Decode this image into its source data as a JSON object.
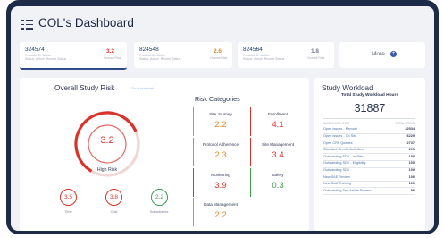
{
  "app": {
    "title": "COL's Dashboard"
  },
  "studies": [
    {
      "id": "324574",
      "subtitle": "Protocol ID: Active\nStatus: Active  Recent Status",
      "score": "3.2",
      "score_color": "#d9342b",
      "overall_label": "Overall Risk"
    },
    {
      "id": "824548",
      "subtitle": "Protocol ID: Active\nStatus: Active  Recent Status",
      "score": "2.6",
      "score_color": "#e08a2a",
      "overall_label": "Overall Risk"
    },
    {
      "id": "824564",
      "subtitle": "Protocol ID: Active\nStatus: Active  Recent Status",
      "score": "1.8",
      "score_color": "#7a8194",
      "overall_label": "Overall Risk"
    }
  ],
  "more": {
    "label": "More",
    "icon": "plus-circle-icon"
  },
  "overall_risk": {
    "title": "Overall Study Risk",
    "link": "Go to study risk",
    "score": "3.2",
    "status": "High Risk",
    "gauge_fraction": 0.72,
    "color": "#d9342b",
    "sub_risks": [
      {
        "label": "Time",
        "value": "3.5",
        "color": "#d9342b"
      },
      {
        "label": "Cost",
        "value": "3.8",
        "color": "#d9342b"
      },
      {
        "label": "Subsidiaries",
        "value": "2.2",
        "color": "#3a9d4a"
      }
    ]
  },
  "risk_categories": {
    "title": "Risk Categories",
    "items": [
      {
        "name": "Site Journey",
        "value": "2.2",
        "color": "#e08a2a"
      },
      {
        "name": "Enrollment",
        "value": "4.1",
        "color": "#d9342b"
      },
      {
        "name": "Protocol Adherence",
        "value": "2.3",
        "color": "#e08a2a"
      },
      {
        "name": "Site Management",
        "value": "3.4",
        "color": "#d9342b"
      },
      {
        "name": "Monitoring",
        "value": "3.9",
        "color": "#d9342b"
      },
      {
        "name": "Safety",
        "value": "0.3",
        "color": "#3a9d4a"
      },
      {
        "name": "Data Management",
        "value": "2.2",
        "color": "#e08a2a"
      }
    ]
  },
  "workload": {
    "title": "Study Workload",
    "heading": "Total Study Workload Hours",
    "total": "31887",
    "columns": [
      "WORKLOAD ITEM",
      "TOTAL ITEMS"
    ],
    "rows": [
      {
        "label": "Open Issues - Remote",
        "value": "22534"
      },
      {
        "label": "Open Issues - On Site",
        "value": "6229"
      },
      {
        "label": "Open CRF Queries",
        "value": "2737"
      },
      {
        "label": "Standard On-site Activities",
        "value": "291"
      },
      {
        "label": "Outstanding SDV - Int/Site",
        "value": "150"
      },
      {
        "label": "Outstanding SDV - Eligibility",
        "value": "100"
      },
      {
        "label": "Outstanding SDV",
        "value": "100"
      },
      {
        "label": "New SAE Review",
        "value": "100"
      },
      {
        "label": "New Staff Training",
        "value": "100"
      },
      {
        "label": "Outstanding Test Article Review",
        "value": "50"
      }
    ]
  }
}
